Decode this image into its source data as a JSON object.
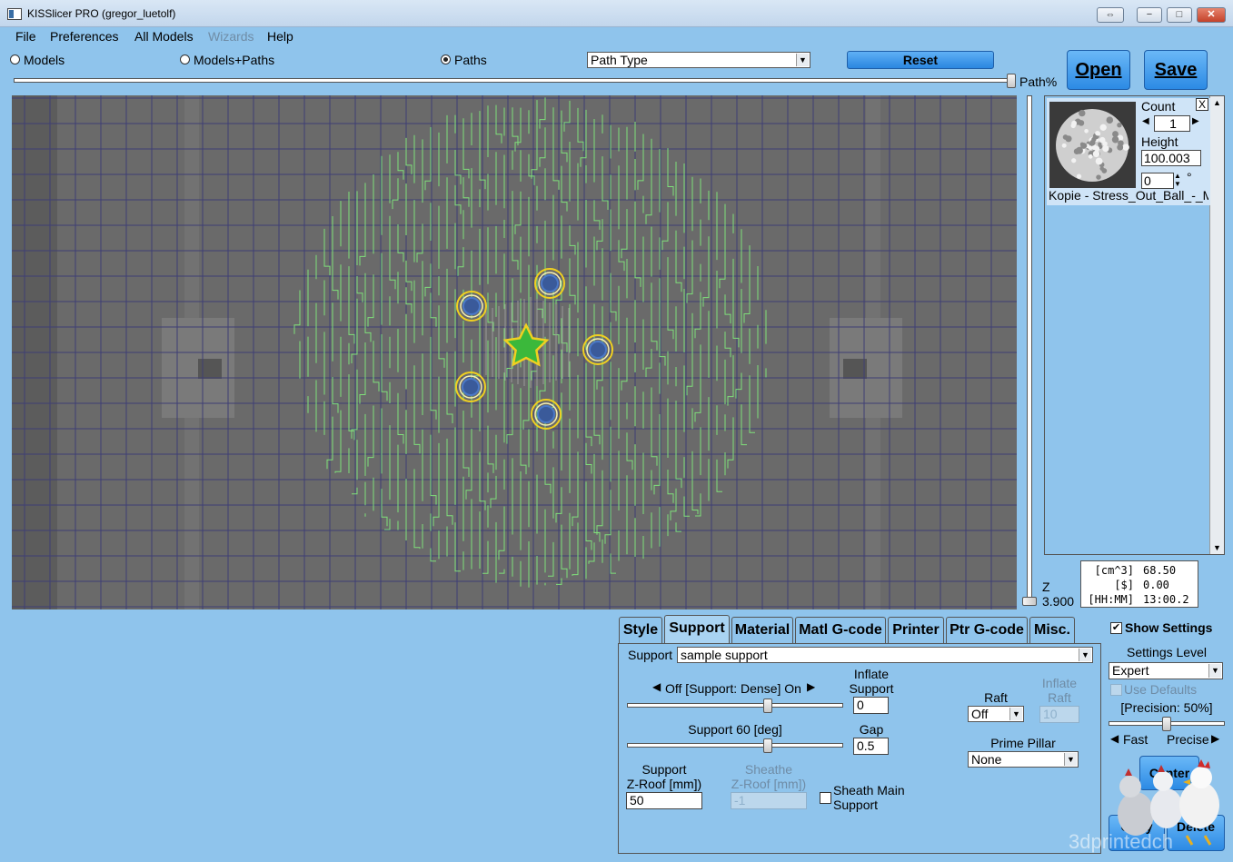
{
  "window": {
    "title": "KISSlicer PRO (gregor_luetolf)",
    "controls": {
      "restore_glyph": "⇔",
      "minimize_glyph": "−",
      "maximize_glyph": "□",
      "close_glyph": "✕"
    }
  },
  "menu": {
    "items": [
      {
        "label": "File",
        "enabled": true
      },
      {
        "label": "Preferences",
        "enabled": true
      },
      {
        "label": "All Models",
        "enabled": true
      },
      {
        "label": "Wizards",
        "enabled": false
      },
      {
        "label": "Help",
        "enabled": true
      }
    ]
  },
  "toolbar": {
    "view_modes": [
      {
        "label": "Models",
        "checked": false
      },
      {
        "label": "Models+Paths",
        "checked": false
      },
      {
        "label": "Paths",
        "checked": true
      }
    ],
    "path_type_select": "Path Type",
    "reset_label": "Reset",
    "open_label": "Open",
    "save_label": "Save",
    "path_percent_label": "Path%",
    "path_percent_value": 1.0
  },
  "layer": {
    "z_label": "Z",
    "z_value": "3.900",
    "z_slider_fraction": 0.0
  },
  "model_panel": {
    "close_glyph": "X",
    "count_label": "Count",
    "count_value": "1",
    "height_label": "Height",
    "height_value": "100.003",
    "rotation_value": "0",
    "rotation_unit": "°",
    "model_name": "Kopie - Stress_Out_Ball_-_M"
  },
  "stats": {
    "volume_unit": "[cm^3]",
    "volume_value": "68.50",
    "cost_unit": "[$]",
    "cost_value": "0.00",
    "time_unit": "[HH:MM]",
    "time_value": "13:00.2"
  },
  "tabs": [
    {
      "label": "Style",
      "active": false
    },
    {
      "label": "Support",
      "active": true
    },
    {
      "label": "Material",
      "active": false
    },
    {
      "label": "Matl G-code",
      "active": false
    },
    {
      "label": "Printer",
      "active": false
    },
    {
      "label": "Ptr G-code",
      "active": false
    },
    {
      "label": "Misc.",
      "active": false
    }
  ],
  "support": {
    "profile_label": "Support",
    "profile_value": "sample support",
    "density_label": "Off [Support: Dense] On",
    "density_fraction": 0.66,
    "inflate_label_1": "Inflate",
    "inflate_label_2": "Support",
    "inflate_value": "0",
    "angle_label": "Support 60 [deg]",
    "angle_fraction": 0.66,
    "gap_label": "Gap",
    "gap_value": "0.5",
    "zroof_label_1": "Support",
    "zroof_label_2": "Z-Roof [mm])",
    "zroof_value": "50",
    "sheathe_label_1": "Sheathe",
    "sheathe_label_2": "Z-Roof [mm])",
    "sheathe_value": "-1",
    "sheath_main_label_1": "Sheath Main",
    "sheath_main_label_2": "Support",
    "sheath_main_checked": false,
    "raft_label": "Raft",
    "raft_value": "Off",
    "inflate_raft_label_1": "Inflate",
    "inflate_raft_label_2": "Raft",
    "inflate_raft_value": "10",
    "prime_pillar_label": "Prime Pillar",
    "prime_pillar_value": "None"
  },
  "settings": {
    "show_settings_label": "Show Settings",
    "show_settings_checked": true,
    "level_label": "Settings Level",
    "level_value": "Expert",
    "use_defaults_label": "Use Defaults",
    "precision_label": "[Precision: 50%]",
    "precision_fraction": 0.5,
    "fast_label": "Fast",
    "precise_label": "Precise",
    "center_label": "Center",
    "copy_label": "Copy",
    "delete_label": "Delete",
    "watermark": "3dprintedch"
  },
  "colors": {
    "background": "#8fc4ec",
    "viewport": "#6a6a6a",
    "grid": "#3e3e74",
    "infill": "#7fe07a",
    "perimeter_outer": "#f0d020",
    "perimeter_inner": "#4a78c8",
    "button_blue": "#2c8ae4"
  }
}
